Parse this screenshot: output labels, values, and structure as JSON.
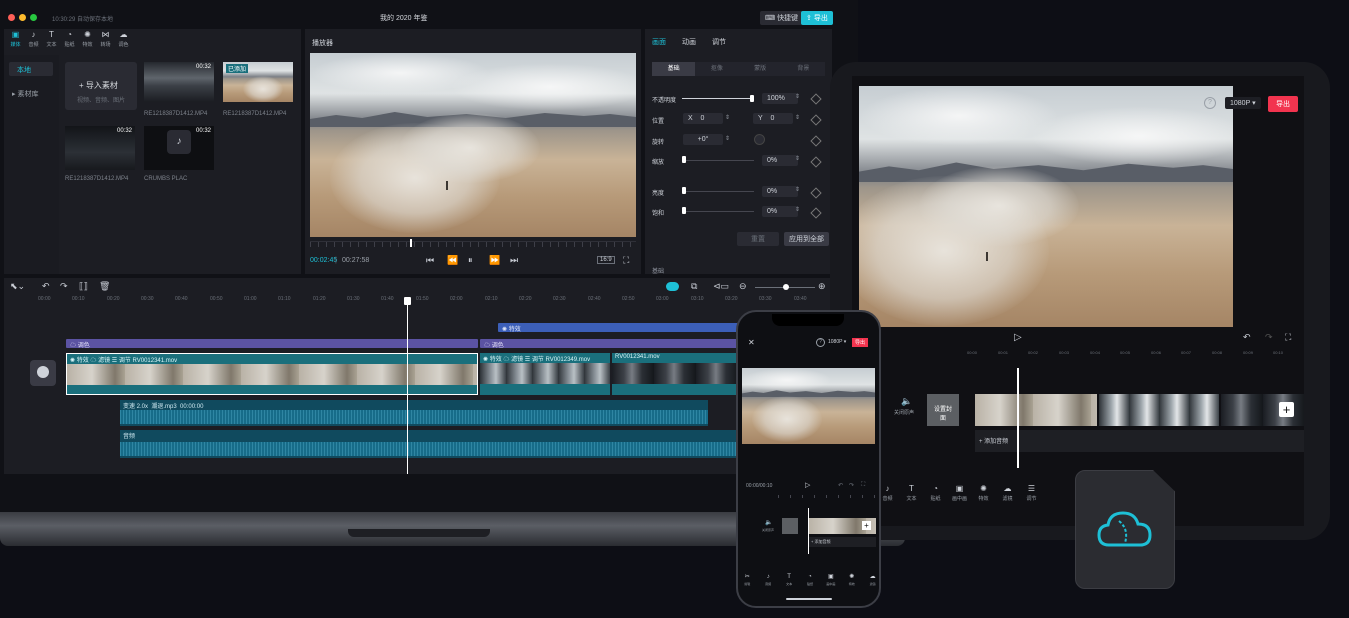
{
  "laptop": {
    "titlebar": {
      "time": "10:30:29 自动保存本地",
      "title": "我的 2020 年鉴",
      "shortcut_label": "快捷键",
      "export_label": "导出"
    },
    "media_tabs": [
      {
        "icon": "media-icon",
        "label": "媒体"
      },
      {
        "icon": "audio-icon",
        "label": "音频"
      },
      {
        "icon": "text-icon",
        "label": "文本"
      },
      {
        "icon": "sticker-icon",
        "label": "贴纸"
      },
      {
        "icon": "effects-icon",
        "label": "特效"
      },
      {
        "icon": "transition-icon",
        "label": "转场"
      },
      {
        "icon": "filter-icon",
        "label": "调色"
      }
    ],
    "left_nav": {
      "local": "本地",
      "library": "素材库"
    },
    "import": {
      "label": "导入素材",
      "hint": "视频、音频、图片"
    },
    "media_items": [
      {
        "duration": "00:32",
        "name": "RE1218387D1412.MP4"
      },
      {
        "duration": "已添加",
        "name": "RE1218387D1412.MP4"
      },
      {
        "duration": "00:32",
        "name": "RE1218387D1412.MP4"
      },
      {
        "duration": "00:32",
        "name": "CRUMBS PLAC"
      }
    ],
    "player": {
      "title": "播放器",
      "current": "00:02:45",
      "total": "00:27:58",
      "ratio": "16:9"
    },
    "inspector": {
      "tabs": [
        "画面",
        "动画",
        "调节"
      ],
      "subtabs": [
        "基础",
        "抠像",
        "蒙版",
        "背景"
      ],
      "opacity_label": "不透明度",
      "opacity_value": "100%",
      "position_label": "位置",
      "x_label": "X",
      "x_value": "0",
      "y_label": "Y",
      "y_value": "0",
      "rotate_label": "旋转",
      "rotate_value": "+0°",
      "scale_label": "缩放",
      "scale_value": "0%",
      "brightness_label": "亮度",
      "brightness_value": "0%",
      "saturation_label": "饱和",
      "saturation_value": "0%",
      "reset_label": "重置",
      "apply_all_label": "应用到全部",
      "footer_label": "基础"
    },
    "timeline": {
      "ruler": [
        "00:00",
        "00:10",
        "00:20",
        "00:30",
        "00:40",
        "00:50",
        "01:00",
        "01:10",
        "01:20",
        "01:30",
        "01:40",
        "01:50",
        "02:00",
        "02:10",
        "02:20",
        "02:30",
        "02:40",
        "02:50",
        "03:00",
        "03:10",
        "03:20",
        "03:30",
        "03:40"
      ],
      "effect_label": "特效",
      "filter_label_1": "调色",
      "filter_label_2": "调色",
      "clip1": {
        "tags": [
          "特效",
          "滤镜",
          "调节"
        ],
        "name": "RV0012341.mov"
      },
      "clip2": {
        "tags": [
          "特效",
          "滤镜",
          "调节"
        ],
        "name": "RV0012349.mov"
      },
      "clip3": {
        "name": "RV0012341.mov"
      },
      "audio1": {
        "speed": "变速 2.0x",
        "name": "潮退.mp3",
        "time": "00:00:00"
      },
      "audio2": {
        "name": "音频"
      }
    }
  },
  "tablet": {
    "quality": "1080P",
    "export_label": "导出",
    "ruler": [
      "00:00",
      "00:01",
      "00:02",
      "00:03",
      "00:04",
      "00:05",
      "00:06",
      "00:07",
      "00:08",
      "00:09",
      "00:10"
    ],
    "mute_label": "关闭原声",
    "cover_label": "设置封面",
    "add_audio": "添加音频",
    "tools": [
      {
        "icon": "audio-icon",
        "label": "音频"
      },
      {
        "icon": "text-icon",
        "label": "文本"
      },
      {
        "icon": "sticker-icon",
        "label": "贴纸"
      },
      {
        "icon": "pip-icon",
        "label": "画中画"
      },
      {
        "icon": "effects-icon",
        "label": "特效"
      },
      {
        "icon": "filter-icon",
        "label": "滤镜"
      },
      {
        "icon": "adjust-icon",
        "label": "调节"
      }
    ]
  },
  "phone": {
    "quality": "1080P",
    "export_label": "导出",
    "time": "00:00/00:10",
    "add_audio": "添加音频",
    "mute_label": "关闭原声",
    "tools": [
      {
        "icon": "scissors-icon",
        "label": "剪辑"
      },
      {
        "icon": "audio-icon",
        "label": "音频"
      },
      {
        "icon": "text-icon",
        "label": "文本"
      },
      {
        "icon": "sticker-icon",
        "label": "贴纸"
      },
      {
        "icon": "pip-icon",
        "label": "画中画"
      },
      {
        "icon": "effects-icon",
        "label": "特效"
      },
      {
        "icon": "filter-icon",
        "label": "滤镜"
      }
    ]
  },
  "colors": {
    "accent": "#1ec0d6",
    "export_red": "#f2344f",
    "panel": "#1c1d23",
    "purple": "#5b53a3",
    "blue": "#3c5fb8",
    "teal": "#1a6f7c",
    "audio": "#176c89"
  }
}
